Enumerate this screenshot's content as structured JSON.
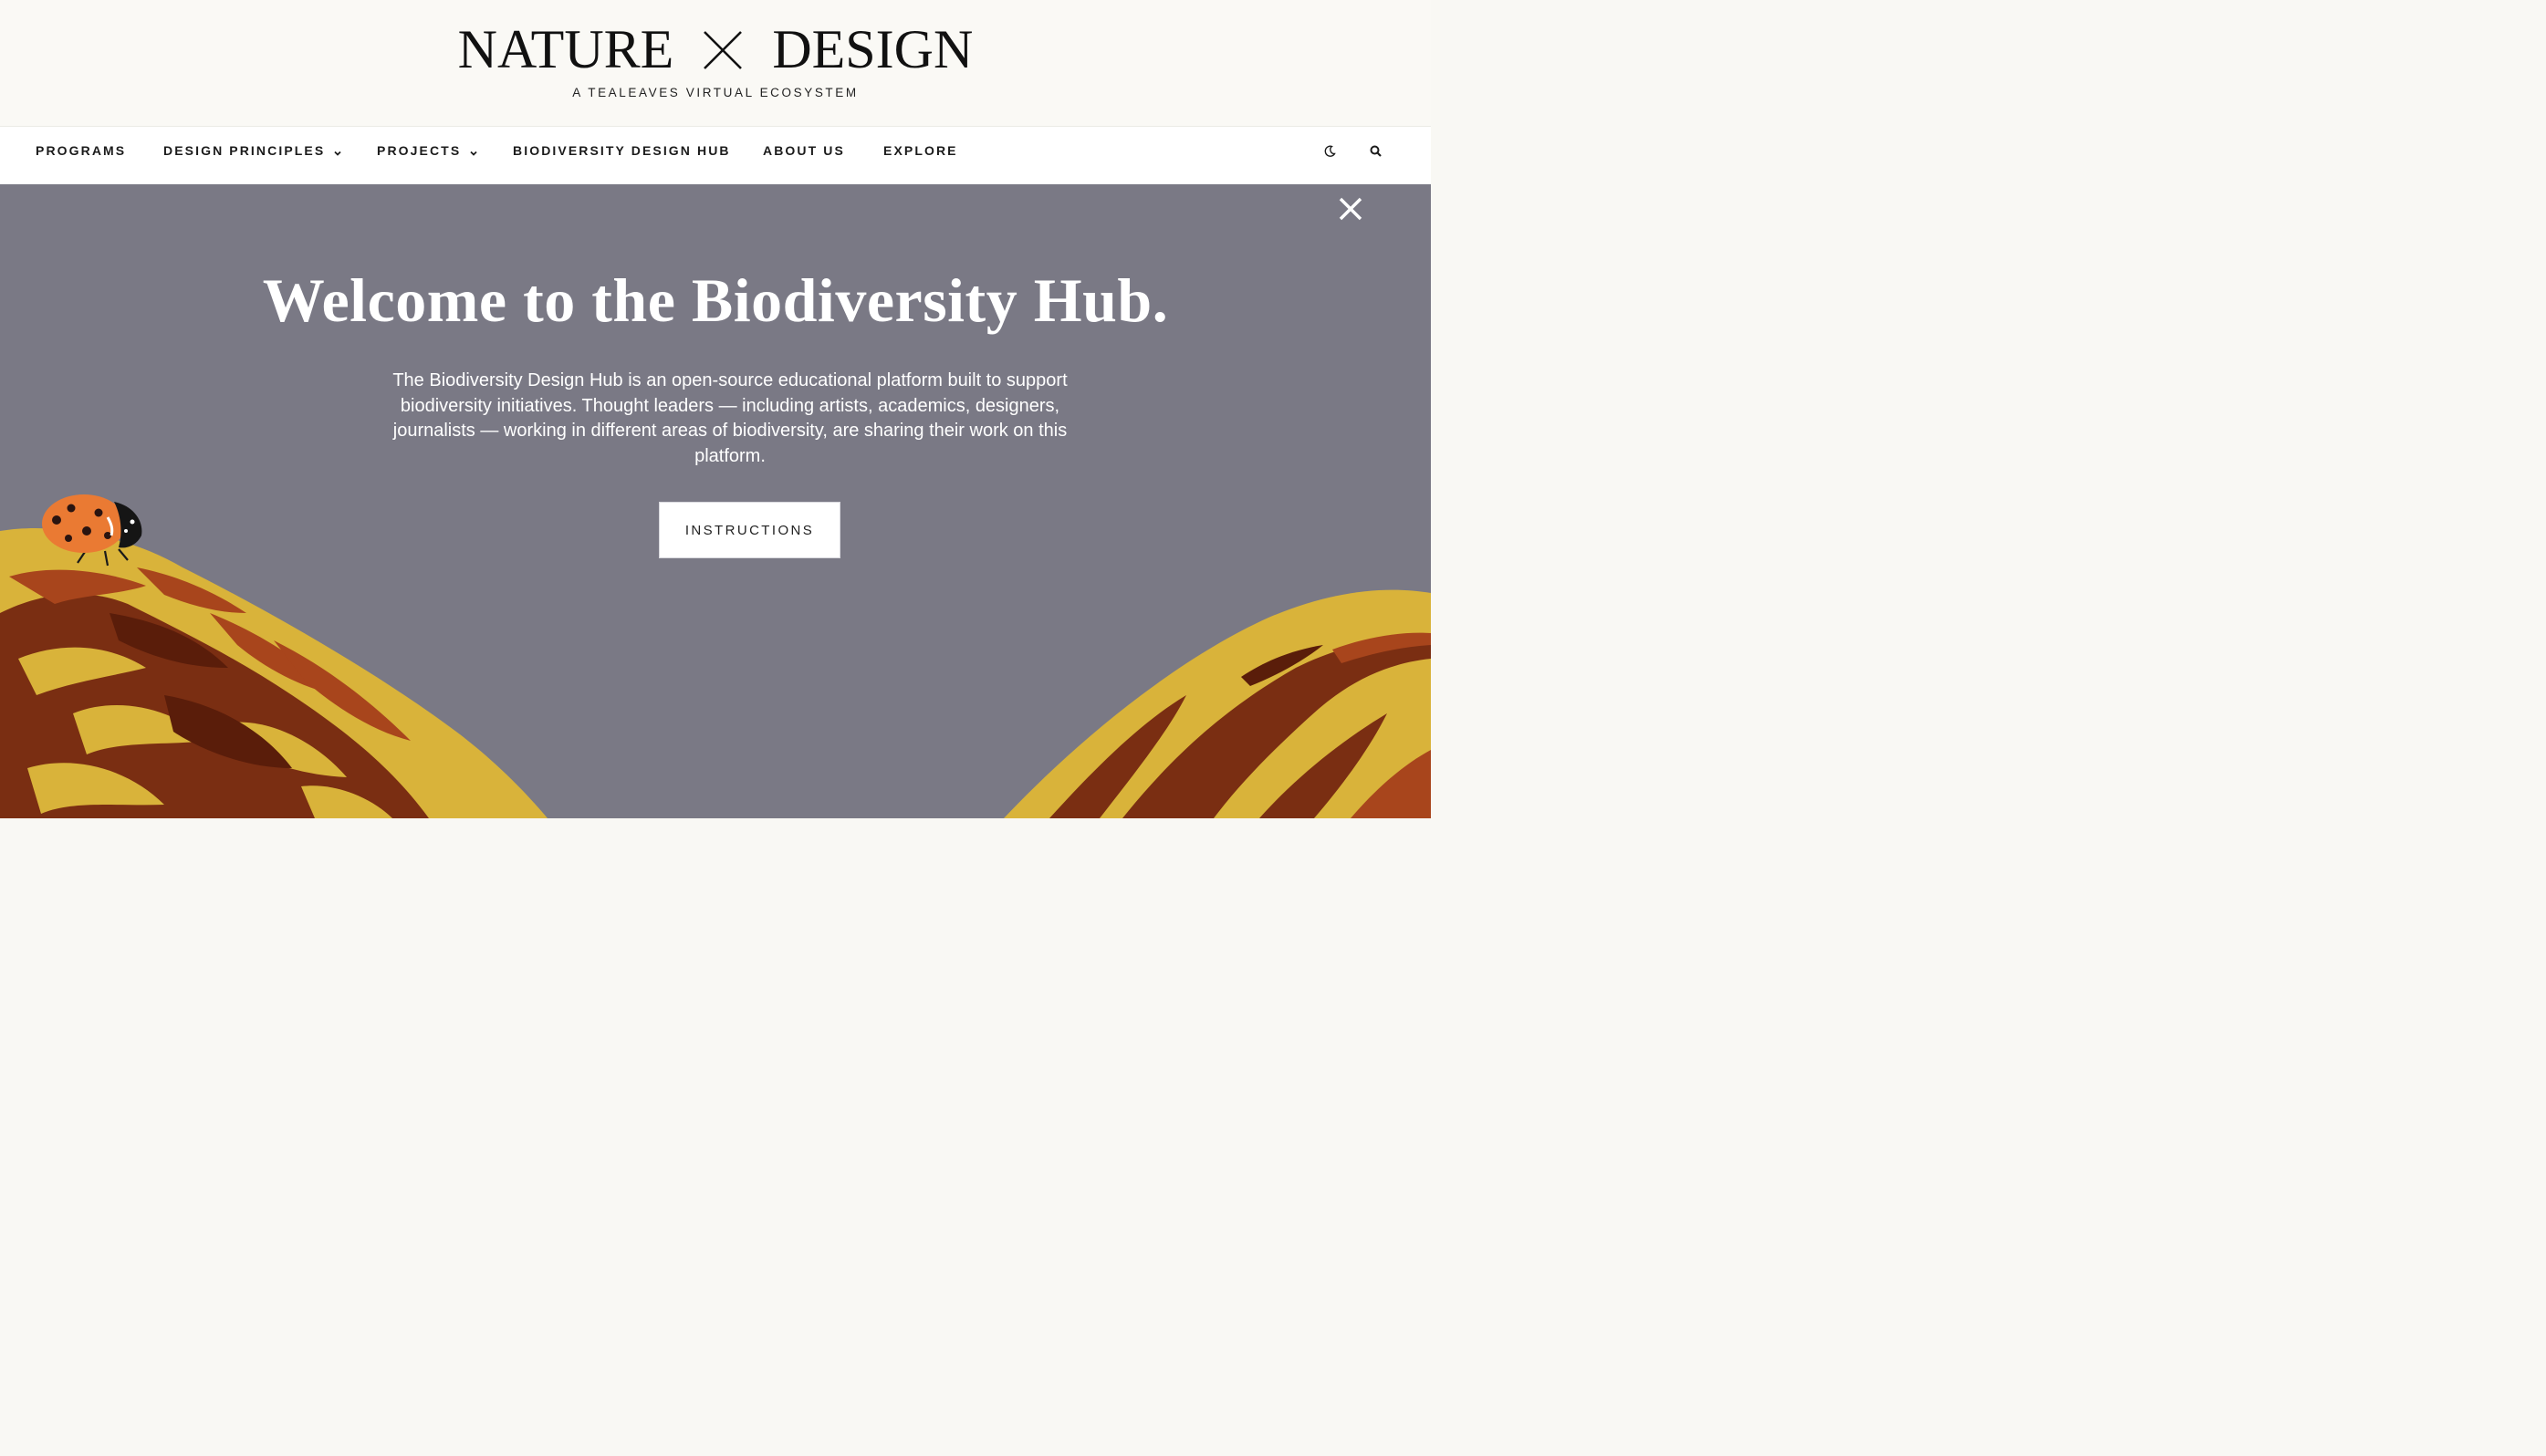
{
  "site": {
    "logo_left": "NATURE",
    "logo_mark": "X",
    "logo_right": "DESIGN",
    "tagline": "A TEALEAVES VIRTUAL ECOSYSTEM"
  },
  "nav": {
    "items": [
      {
        "label": "PROGRAMS",
        "has_dropdown": false
      },
      {
        "label": "DESIGN PRINCIPLES",
        "has_dropdown": true
      },
      {
        "label": "PROJECTS",
        "has_dropdown": true
      },
      {
        "label": "BIODIVERSITY DESIGN HUB",
        "has_dropdown": false
      },
      {
        "label": "ABOUT US",
        "has_dropdown": false
      },
      {
        "label": "EXPLORE",
        "has_dropdown": false
      }
    ],
    "icons": [
      "moon-icon",
      "search-icon"
    ]
  },
  "hero": {
    "title": "Welcome to the Biodiversity Hub.",
    "description": "The Biodiversity Design Hub is an open-source educational platform built to support biodiversity initiatives. Thought leaders — including artists, academics, designers, journalists — working in different areas of biodiversity, are sharing their work on this platform.",
    "button_label": "INSTRUCTIONS",
    "close_icon": "close-icon"
  },
  "colors": {
    "hero_background": "#7a7985",
    "masthead_background": "#faf9f5",
    "mound_yellow": "#d9b33a",
    "mound_brown": "#7a2e12",
    "ladybug_orange": "#ea7a33"
  }
}
